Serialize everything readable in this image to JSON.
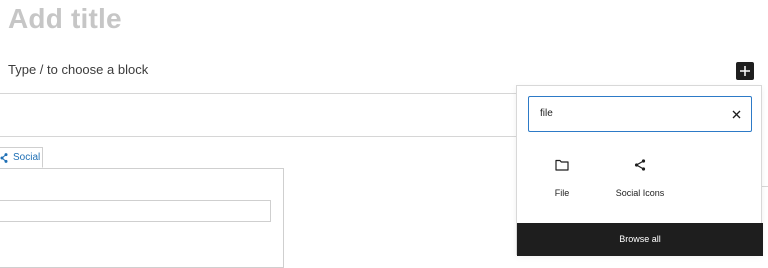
{
  "editor": {
    "title_placeholder": "Add title",
    "block_placeholder": "Type / to choose a block",
    "inserter_icon": "plus-icon"
  },
  "social_block": {
    "tab_label": "Social",
    "tab_icon": "share-icon",
    "accent_color": "#1e6fb5"
  },
  "inserter": {
    "search": {
      "value": "file",
      "clear_icon": "close-icon",
      "focus_color": "#2d7ac7"
    },
    "results": [
      {
        "label": "File",
        "icon": "folder-icon"
      },
      {
        "label": "Social Icons",
        "icon": "share-icon"
      }
    ],
    "browse_all_label": "Browse all",
    "browse_all_bg": "#1e1e1e"
  }
}
